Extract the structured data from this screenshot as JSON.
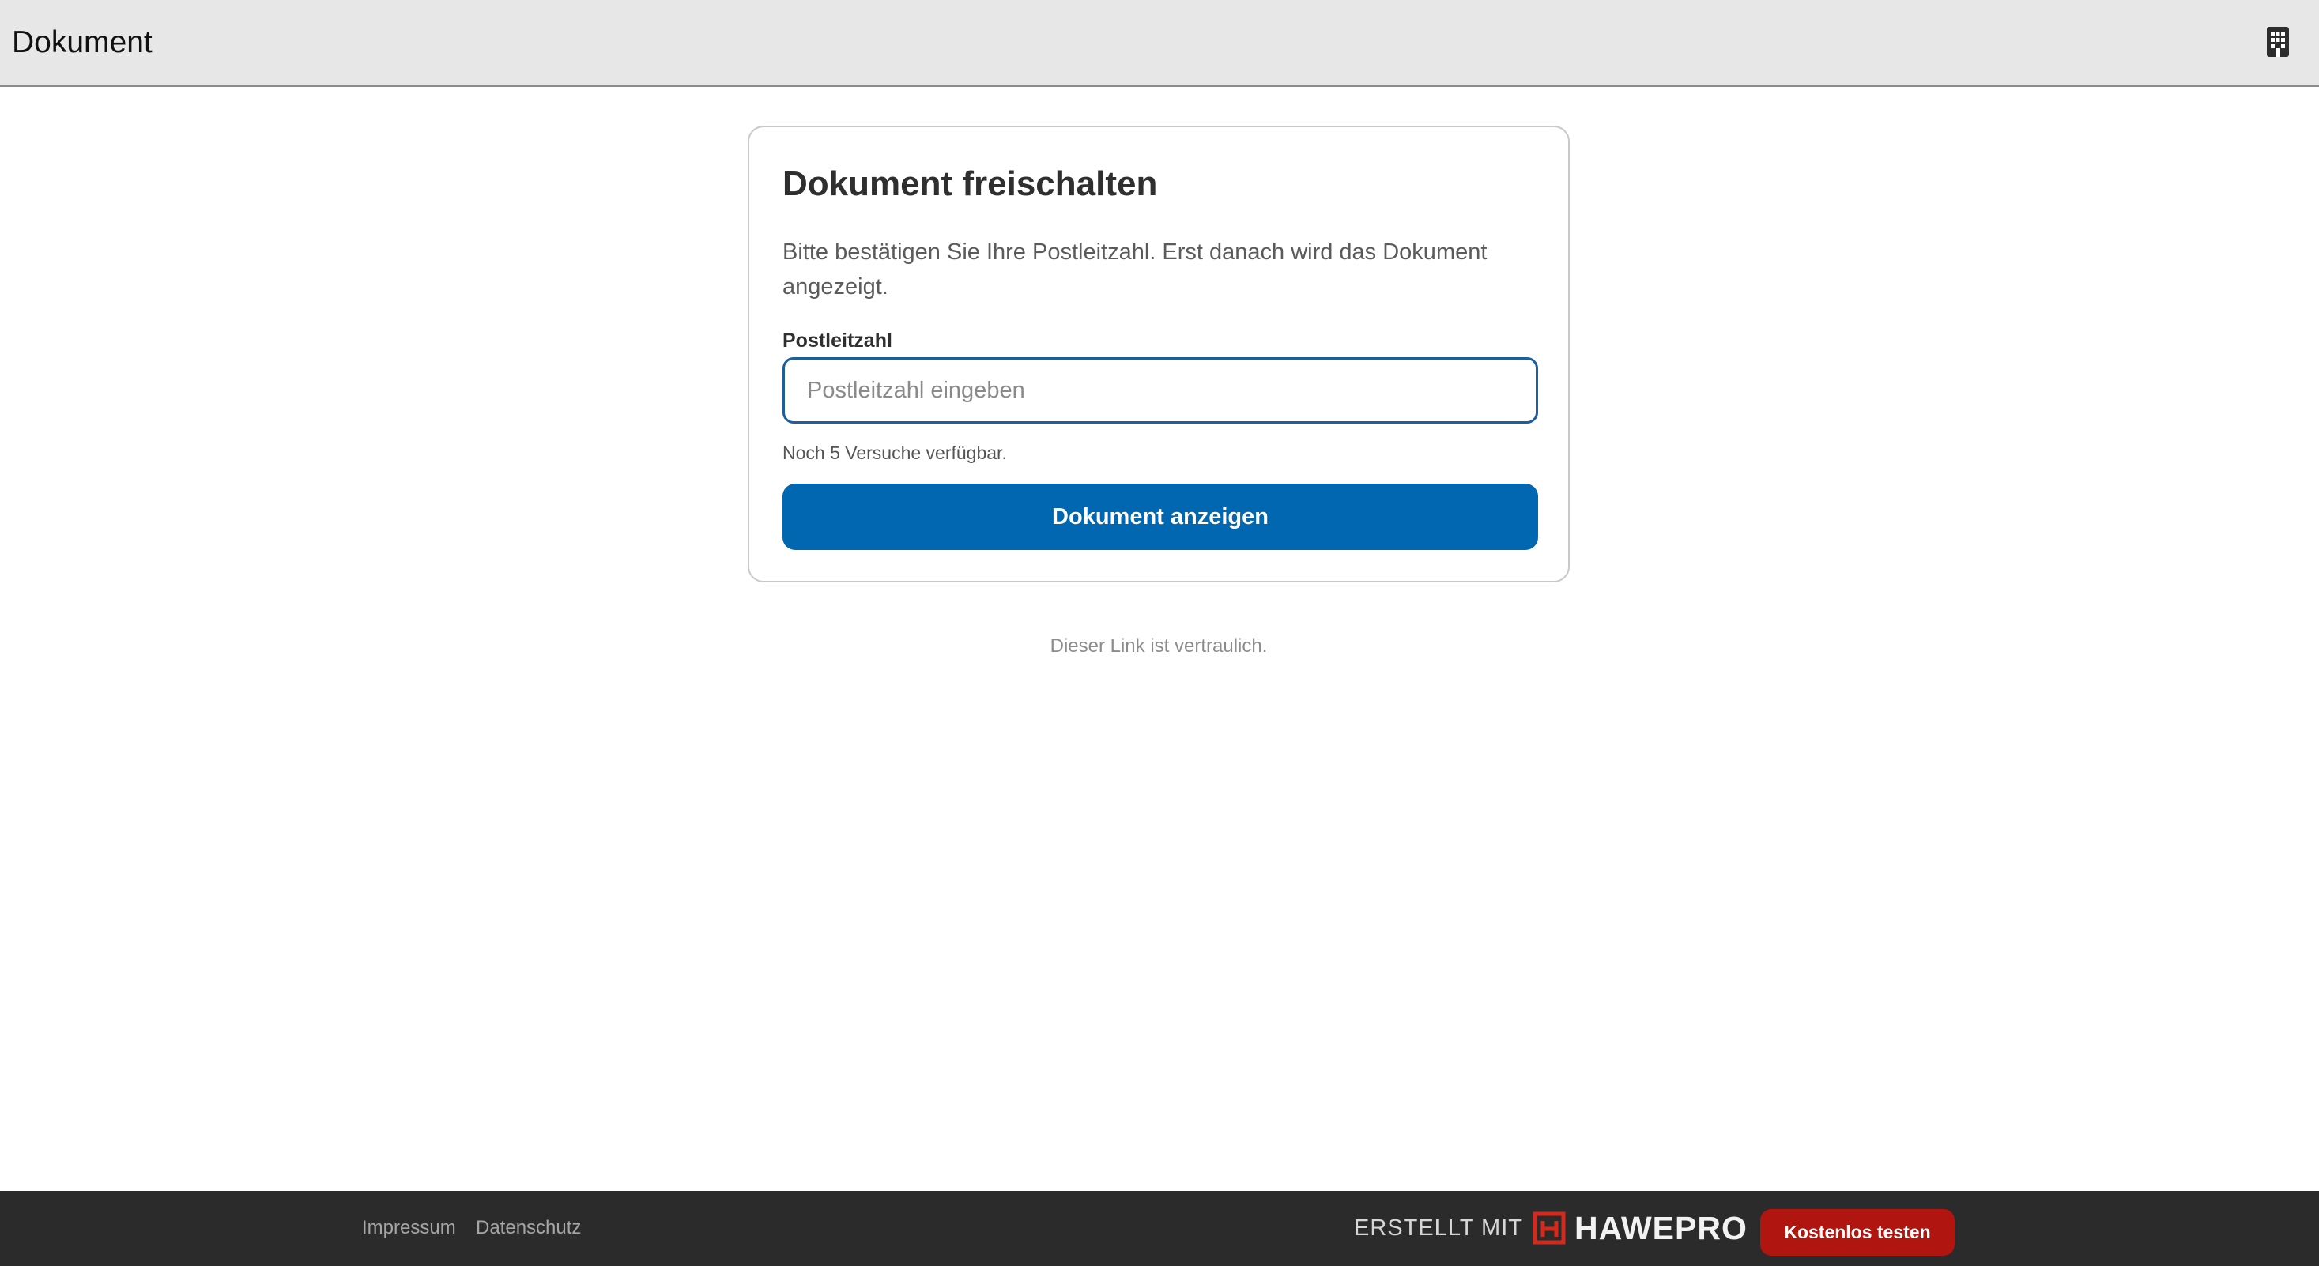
{
  "header": {
    "title": "Dokument",
    "icon": "building-icon"
  },
  "card": {
    "title": "Dokument freischalten",
    "description": "Bitte bestätigen Sie Ihre Postleitzahl. Erst danach wird das Dokument angezeigt.",
    "field_label": "Postleitzahl",
    "input_value": "",
    "input_placeholder": "Postleitzahl eingeben",
    "attempts_hint": "Noch 5 Versuche verfügbar.",
    "submit_label": "Dokument anzeigen"
  },
  "confidential_note": "Dieser Link ist vertraulich.",
  "footer": {
    "links": [
      "Impressum",
      "Datenschutz"
    ],
    "built_with": "ERSTELLT MIT",
    "brand_name": "HAWEPRO",
    "brand_icon": "hawepro-logo-icon",
    "trial_label": "Kostenlos testen"
  },
  "colors": {
    "header_bg": "#e7e7e7",
    "primary": "#0067b0",
    "footer_bg": "#2b2b2b",
    "trial_button": "#b0160f",
    "brand_logo": "#d42a1e"
  }
}
